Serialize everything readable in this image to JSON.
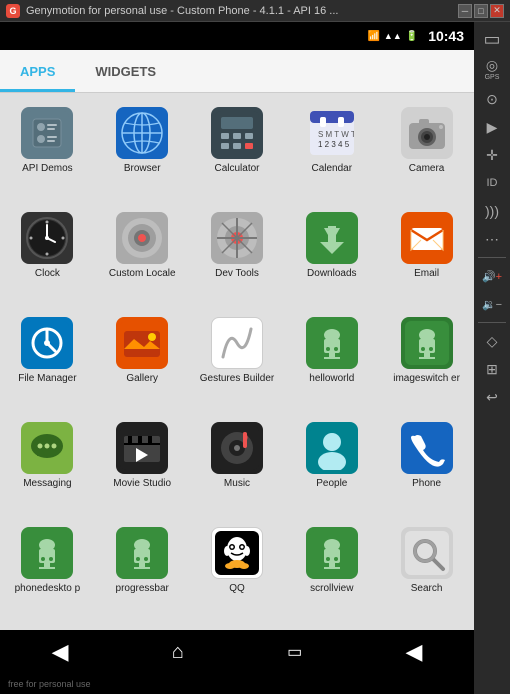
{
  "titleBar": {
    "text": "Genymotion for personal use - Custom Phone - 4.1.1 - API 16 ...",
    "icon": "G"
  },
  "statusBar": {
    "time": "10:43",
    "battery": "🔋",
    "signal": "📶"
  },
  "tabs": [
    {
      "id": "apps",
      "label": "APPS",
      "active": true
    },
    {
      "id": "widgets",
      "label": "WIDGETS",
      "active": false
    }
  ],
  "apps": [
    {
      "id": "api-demos",
      "label": "API Demos",
      "icon": "⚙",
      "color": "gray"
    },
    {
      "id": "browser",
      "label": "Browser",
      "icon": "🌐",
      "color": "blue-dark"
    },
    {
      "id": "calculator",
      "label": "Calculator",
      "icon": "🧮",
      "color": "dark"
    },
    {
      "id": "calendar",
      "label": "Calendar",
      "icon": "🗺",
      "color": "light-gray"
    },
    {
      "id": "camera",
      "label": "Camera",
      "icon": "📷",
      "color": "light-gray"
    },
    {
      "id": "clock",
      "label": "Clock",
      "icon": "🕐",
      "color": "clock"
    },
    {
      "id": "custom-locale",
      "label": "Custom Locale",
      "icon": "⚙",
      "color": "light-gray"
    },
    {
      "id": "dev-tools",
      "label": "Dev Tools",
      "icon": "⚙",
      "color": "light-gray"
    },
    {
      "id": "downloads",
      "label": "Downloads",
      "icon": "⬇",
      "color": "green"
    },
    {
      "id": "email",
      "label": "Email",
      "icon": "✉",
      "color": "orange"
    },
    {
      "id": "file-manager",
      "label": "File Manager",
      "icon": "📁",
      "color": "blue"
    },
    {
      "id": "gallery",
      "label": "Gallery",
      "icon": "🌅",
      "color": "orange"
    },
    {
      "id": "gestures-builder",
      "label": "Gestures Builder",
      "icon": "✍",
      "color": "white-bg"
    },
    {
      "id": "helloworld",
      "label": "helloworld",
      "icon": "📦",
      "color": "green"
    },
    {
      "id": "imageswitcher",
      "label": "imageswitch er",
      "icon": "📦",
      "color": "green"
    },
    {
      "id": "messaging",
      "label": "Messaging",
      "icon": "💬",
      "color": "lime"
    },
    {
      "id": "movie-studio",
      "label": "Movie Studio",
      "icon": "🎬",
      "color": "dark"
    },
    {
      "id": "music",
      "label": "Music",
      "icon": "🎵",
      "color": "dark"
    },
    {
      "id": "people",
      "label": "People",
      "icon": "👤",
      "color": "cyan"
    },
    {
      "id": "phone",
      "label": "Phone",
      "icon": "📞",
      "color": "blue"
    },
    {
      "id": "phonedesktop",
      "label": "phonedeskto p",
      "icon": "🤖",
      "color": "green"
    },
    {
      "id": "progressbar",
      "label": "progressbar",
      "icon": "🤖",
      "color": "green"
    },
    {
      "id": "qq",
      "label": "QQ",
      "icon": "🐧",
      "color": "white-bg"
    },
    {
      "id": "scrollview",
      "label": "scrollview",
      "icon": "🤖",
      "color": "green"
    },
    {
      "id": "search",
      "label": "Search",
      "icon": "🔍",
      "color": "light-gray"
    }
  ],
  "navbar": {
    "back": "◀",
    "home": "⌂",
    "recent": "▭",
    "back_right": "◀"
  },
  "sidebar": {
    "icons": [
      {
        "id": "battery",
        "symbol": "🔋"
      },
      {
        "id": "gps",
        "label": "GPS",
        "symbol": "◎"
      },
      {
        "id": "camera-side",
        "symbol": "⊙"
      },
      {
        "id": "rotate",
        "symbol": "⤢"
      },
      {
        "id": "id-card",
        "symbol": "▭"
      },
      {
        "id": "rss",
        "symbol": ")"
      },
      {
        "id": "more",
        "symbol": "⋯"
      },
      {
        "id": "volume-up",
        "symbol": "🔊"
      },
      {
        "id": "volume-down",
        "symbol": "🔉"
      },
      {
        "id": "rotate2",
        "symbol": "◇"
      },
      {
        "id": "zoom",
        "symbol": "⊞"
      },
      {
        "id": "back-arrow",
        "symbol": "↩"
      }
    ]
  },
  "bottomBar": {
    "text": "free for personal use"
  }
}
